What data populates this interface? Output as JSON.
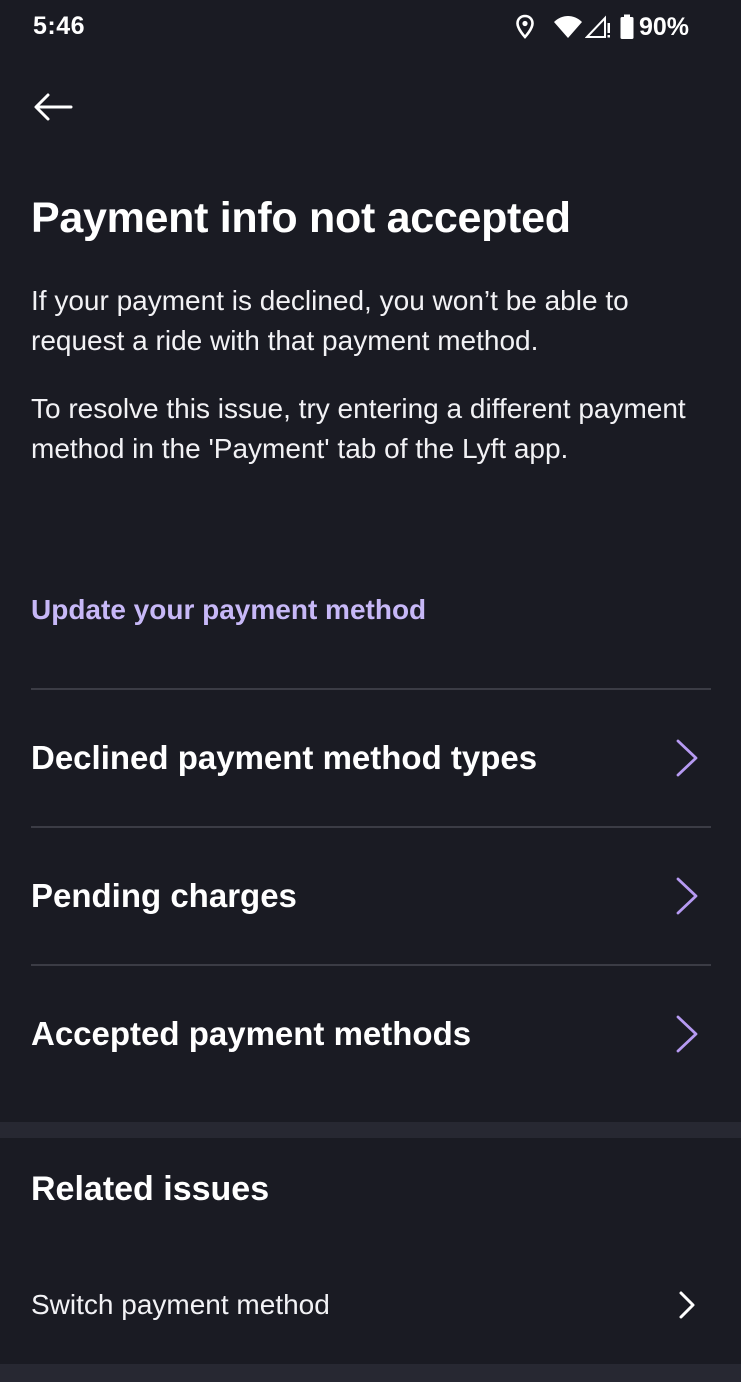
{
  "status_bar": {
    "time": "5:46",
    "battery": "90%",
    "icons": [
      "location-icon",
      "wifi-icon",
      "signal-icon",
      "battery-icon"
    ]
  },
  "header": {
    "back_icon": "arrow-left-icon"
  },
  "article": {
    "title": "Payment info not accepted",
    "paragraphs": [
      "If your payment is declined, you won’t be able to request a ride with that payment method.",
      "To resolve this issue, try entering a different payment method in the 'Payment' tab of the Lyft app."
    ],
    "action_link": "Update your payment method"
  },
  "topics": [
    {
      "label": "Declined payment method types",
      "icon": "chevron-right-icon"
    },
    {
      "label": "Pending charges",
      "icon": "chevron-right-icon"
    },
    {
      "label": "Accepted payment methods",
      "icon": "chevron-right-icon"
    }
  ],
  "related": {
    "heading": "Related issues",
    "items": [
      {
        "label": "Switch payment method",
        "icon": "chevron-right-icon"
      }
    ]
  },
  "colors": {
    "background": "#1a1b23",
    "accent": "#c7b8f7",
    "chevron": "#b69af2",
    "divider": "#3b3c45",
    "section_gap": "#272832"
  }
}
